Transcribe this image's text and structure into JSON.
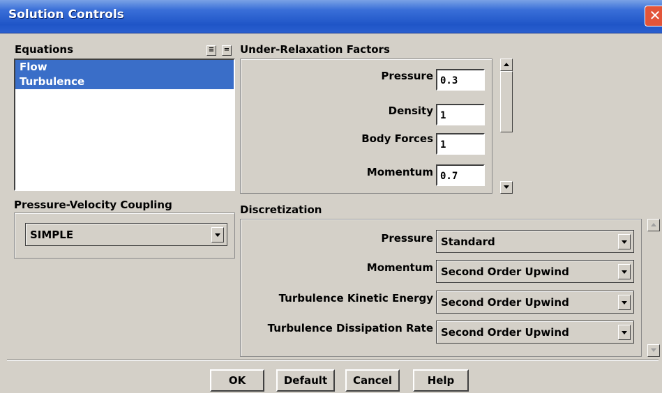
{
  "window": {
    "title": "Solution Controls"
  },
  "equations": {
    "label": "Equations",
    "items": [
      "Flow",
      "Turbulence"
    ]
  },
  "under_relaxation": {
    "label": "Under-Relaxation Factors",
    "fields": [
      {
        "label": "Pressure",
        "value": "0.3"
      },
      {
        "label": "Density",
        "value": "1"
      },
      {
        "label": "Body Forces",
        "value": "1"
      },
      {
        "label": "Momentum",
        "value": "0.7"
      }
    ]
  },
  "coupling": {
    "label": "Pressure-Velocity Coupling",
    "value": "SIMPLE"
  },
  "discretization": {
    "label": "Discretization",
    "fields": [
      {
        "label": "Pressure",
        "value": "Standard"
      },
      {
        "label": "Momentum",
        "value": "Second Order Upwind"
      },
      {
        "label": "Turbulence Kinetic Energy",
        "value": "Second Order Upwind"
      },
      {
        "label": "Turbulence Dissipation Rate",
        "value": "Second Order Upwind"
      }
    ]
  },
  "buttons": {
    "ok": "OK",
    "default": "Default",
    "cancel": "Cancel",
    "help": "Help"
  },
  "colors": {
    "titlebar": "#2a5fcf",
    "selection": "#3a6ec8",
    "background": "#d4d0c8",
    "close": "#e2553a"
  },
  "icons": [
    "close-icon",
    "list-multi-select-icon",
    "list-single-select-icon",
    "scroll-up-icon",
    "scroll-down-icon",
    "dropdown-arrow-icon"
  ]
}
